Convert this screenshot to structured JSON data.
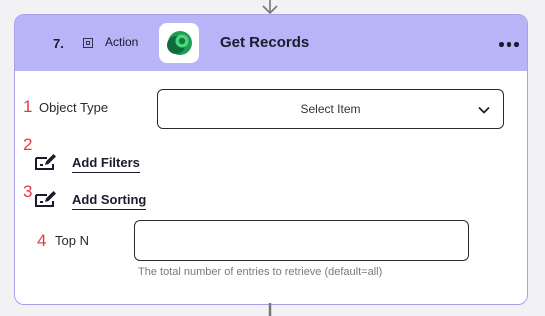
{
  "header": {
    "step_number": "7.",
    "type_label": "Action",
    "title": "Get Records",
    "type_icon": "action-square-icon",
    "app_icon": "dataverse-logo",
    "menu_icon": "more-dots-icon",
    "background_color": "#b7b4f7"
  },
  "fields": {
    "object_type": {
      "badge": "1",
      "label": "Object Type",
      "value": "Select Item"
    },
    "filters": {
      "badge": "2",
      "label": "Add Filters",
      "icon": "edit-icon"
    },
    "sorting": {
      "badge": "3",
      "label": "Add Sorting",
      "icon": "edit-icon"
    },
    "top_n": {
      "badge": "4",
      "label": "Top N",
      "value": "",
      "help": "The total number of entries to retrieve (default=all)"
    }
  },
  "colors": {
    "badge": "#e53a3a",
    "card_border": "#a5a1ee",
    "logo_green": "#1f9d55"
  }
}
